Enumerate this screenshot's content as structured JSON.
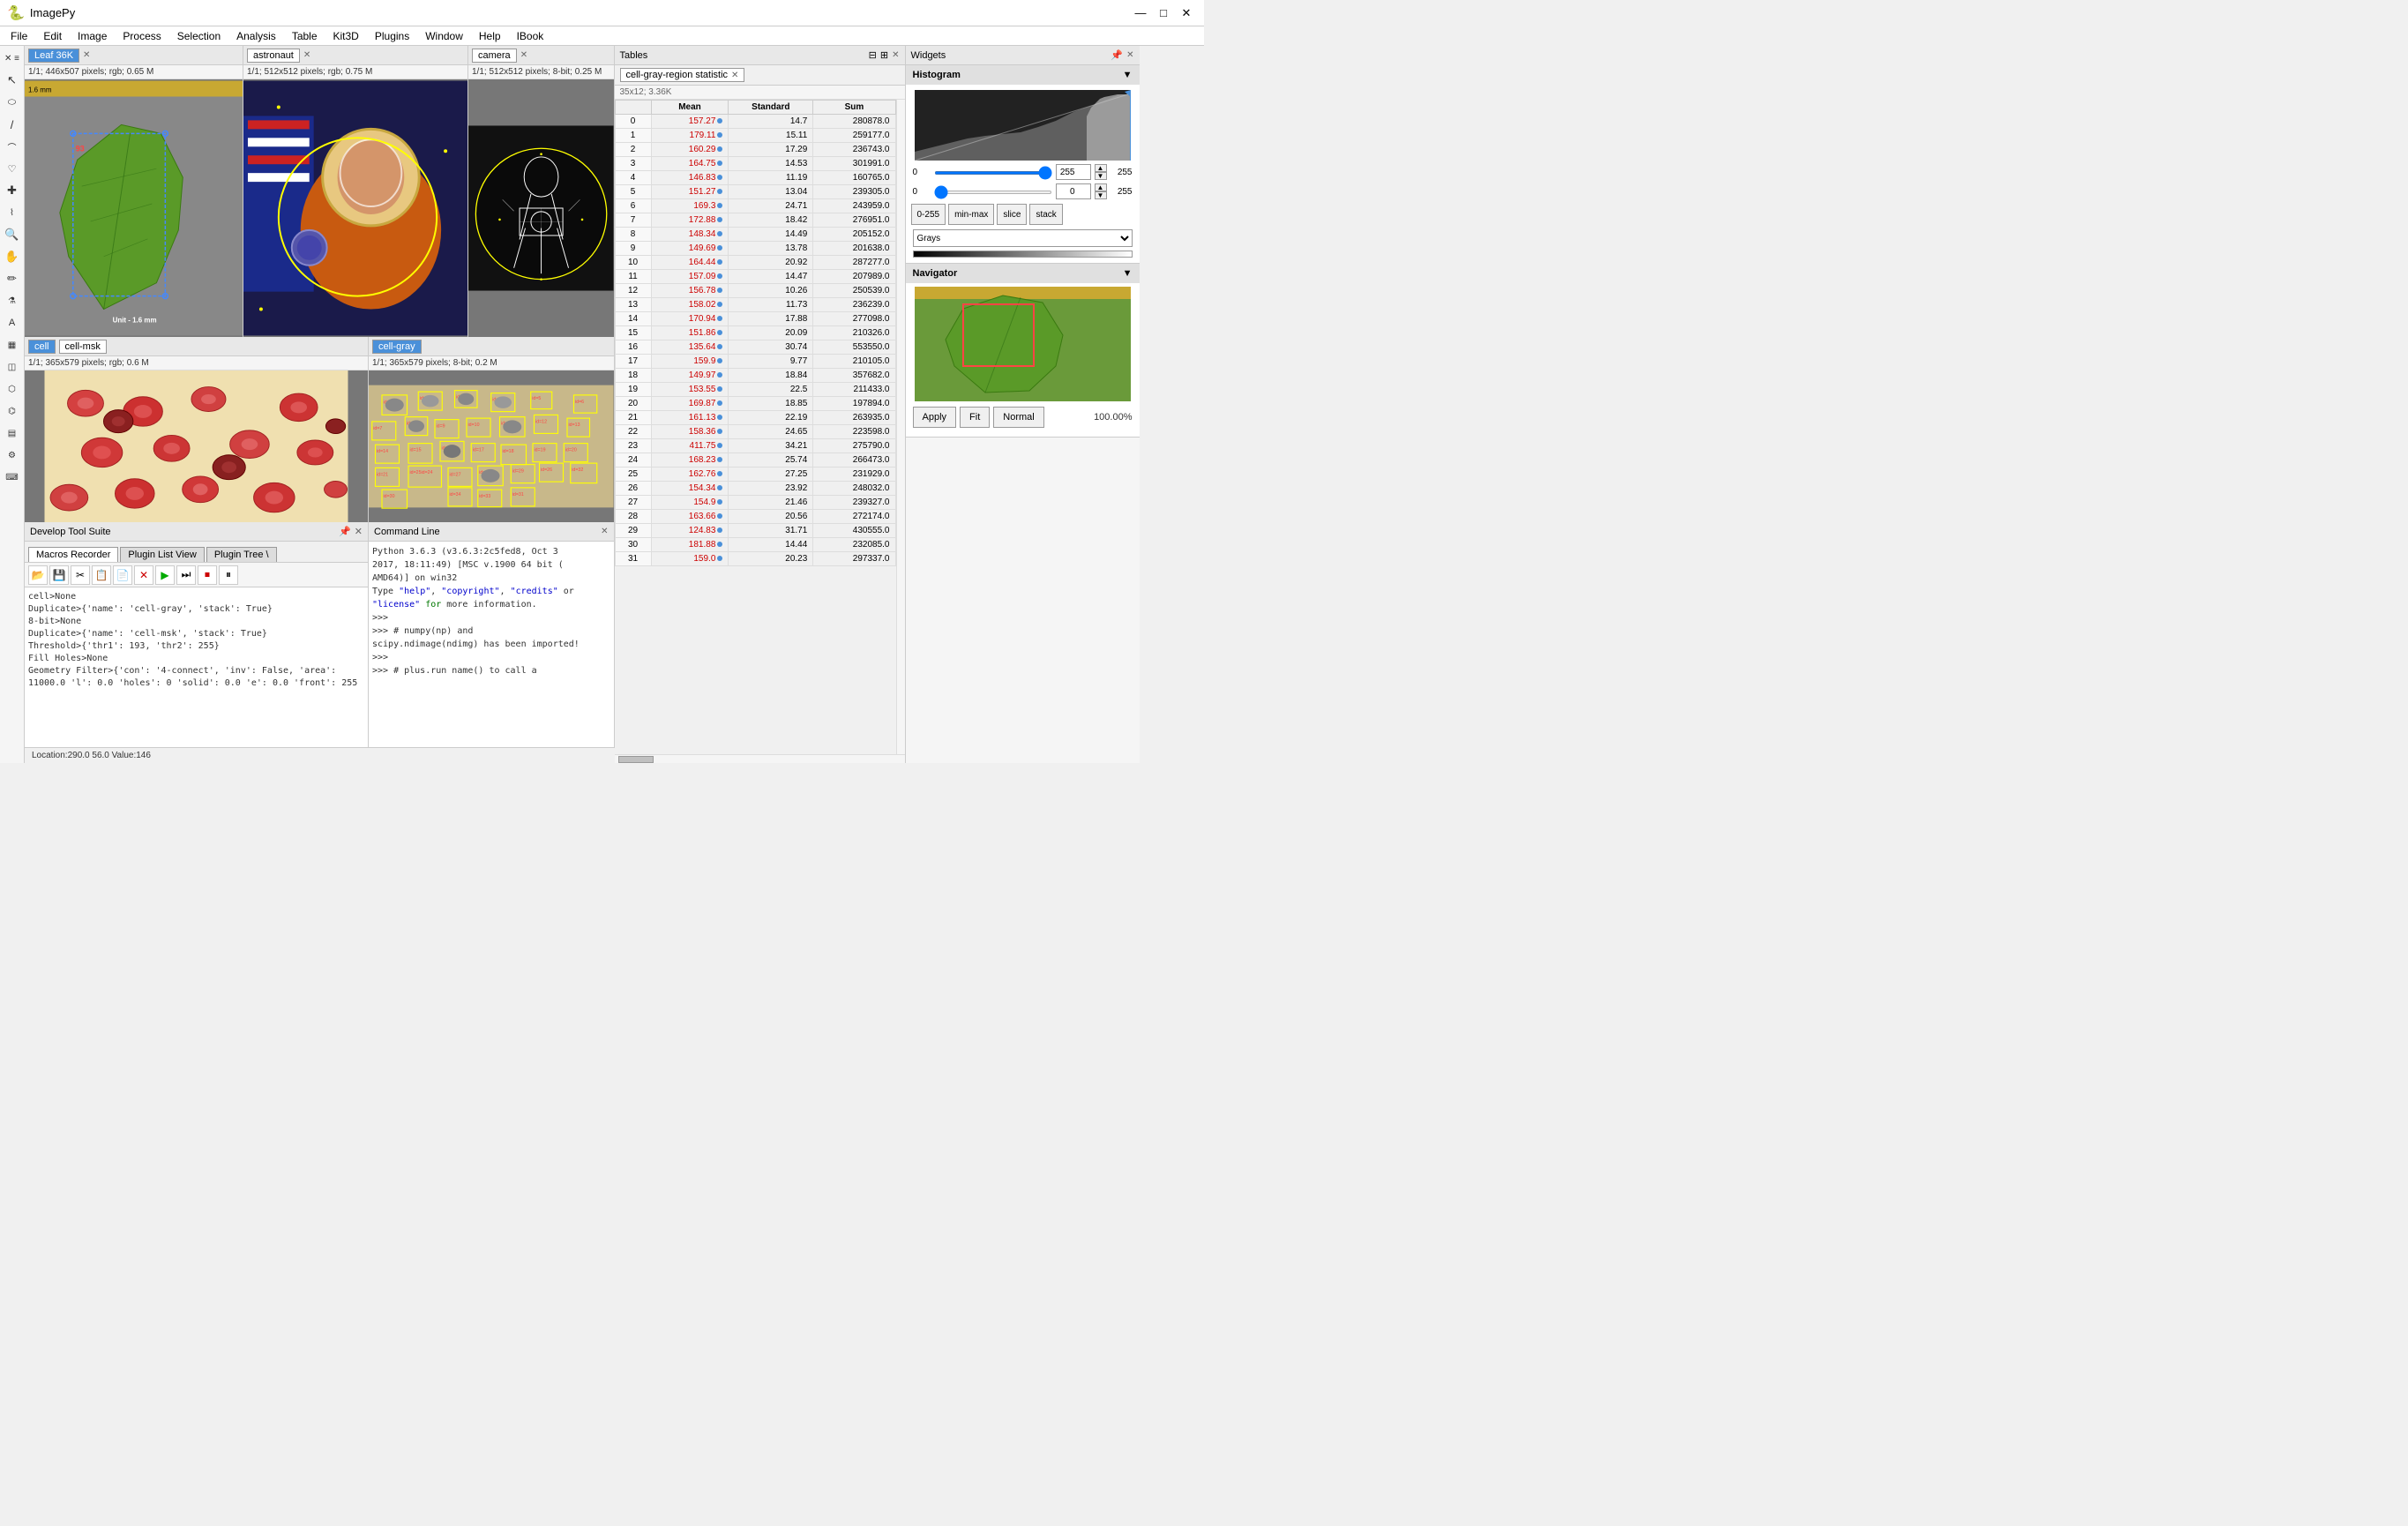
{
  "app": {
    "title": "ImagePy",
    "icon": "🐍"
  },
  "titlebar": {
    "title": "ImagePy",
    "minimize": "—",
    "maximize": "□",
    "close": "✕"
  },
  "menubar": {
    "items": [
      "File",
      "Edit",
      "Image",
      "Process",
      "Selection",
      "Analysis",
      "Table",
      "Kit3D",
      "Plugins",
      "Window",
      "Help",
      "IBook"
    ]
  },
  "tabs": {
    "leaf": "Leaf 36K",
    "astronaut": "astronaut",
    "camera": "camera",
    "cell": "cell",
    "cellmsk": "cell-msk",
    "cellgray": "cell-gray"
  },
  "image_info": {
    "leaf": "1/1;  446x507 pixels; rgb; 0.65 M",
    "astronaut": "1/1;  512x512 pixels; rgb; 0.75 M",
    "camera": "1/1;  512x512 pixels; 8-bit; 0.25 M",
    "cell": "1/1;  365x579 pixels; rgb; 0.6 M",
    "cellgray": "1/1;  365x579 pixels; 8-bit; 0.2 M"
  },
  "tables": {
    "header": "Tables",
    "tab_name": "cell-gray-region statistic",
    "info": "35x12; 3.36K",
    "columns": [
      "",
      "Mean",
      "Standard",
      "Sum"
    ],
    "rows": [
      {
        "idx": "0",
        "mean": "157.27",
        "std": "14.7",
        "sum": "280878.0"
      },
      {
        "idx": "1",
        "mean": "179.11",
        "std": "15.11",
        "sum": "259177.0"
      },
      {
        "idx": "2",
        "mean": "160.29",
        "std": "17.29",
        "sum": "236743.0"
      },
      {
        "idx": "3",
        "mean": "164.75",
        "std": "14.53",
        "sum": "301991.0"
      },
      {
        "idx": "4",
        "mean": "146.83",
        "std": "11.19",
        "sum": "160765.0"
      },
      {
        "idx": "5",
        "mean": "151.27",
        "std": "13.04",
        "sum": "239305.0"
      },
      {
        "idx": "6",
        "mean": "169.3",
        "std": "24.71",
        "sum": "243959.0"
      },
      {
        "idx": "7",
        "mean": "172.88",
        "std": "18.42",
        "sum": "276951.0"
      },
      {
        "idx": "8",
        "mean": "148.34",
        "std": "14.49",
        "sum": "205152.0"
      },
      {
        "idx": "9",
        "mean": "149.69",
        "std": "13.78",
        "sum": "201638.0"
      },
      {
        "idx": "10",
        "mean": "164.44",
        "std": "20.92",
        "sum": "287277.0"
      },
      {
        "idx": "11",
        "mean": "157.09",
        "std": "14.47",
        "sum": "207989.0"
      },
      {
        "idx": "12",
        "mean": "156.78",
        "std": "10.26",
        "sum": "250539.0"
      },
      {
        "idx": "13",
        "mean": "158.02",
        "std": "11.73",
        "sum": "236239.0"
      },
      {
        "idx": "14",
        "mean": "170.94",
        "std": "17.88",
        "sum": "277098.0"
      },
      {
        "idx": "15",
        "mean": "151.86",
        "std": "20.09",
        "sum": "210326.0"
      },
      {
        "idx": "16",
        "mean": "135.64",
        "std": "30.74",
        "sum": "553550.0"
      },
      {
        "idx": "17",
        "mean": "159.9",
        "std": "9.77",
        "sum": "210105.0"
      },
      {
        "idx": "18",
        "mean": "149.97",
        "std": "18.84",
        "sum": "357682.0"
      },
      {
        "idx": "19",
        "mean": "153.55",
        "std": "22.5",
        "sum": "211433.0"
      },
      {
        "idx": "20",
        "mean": "169.87",
        "std": "18.85",
        "sum": "197894.0"
      },
      {
        "idx": "21",
        "mean": "161.13",
        "std": "22.19",
        "sum": "263935.0"
      },
      {
        "idx": "22",
        "mean": "158.36",
        "std": "24.65",
        "sum": "223598.0"
      },
      {
        "idx": "23",
        "mean": "411.75",
        "std": "34.21",
        "sum": "275790.0"
      },
      {
        "idx": "24",
        "mean": "168.23",
        "std": "25.74",
        "sum": "266473.0"
      },
      {
        "idx": "25",
        "mean": "162.76",
        "std": "27.25",
        "sum": "231929.0"
      },
      {
        "idx": "26",
        "mean": "154.34",
        "std": "23.92",
        "sum": "248032.0"
      },
      {
        "idx": "27",
        "mean": "154.9",
        "std": "21.46",
        "sum": "239327.0"
      },
      {
        "idx": "28",
        "mean": "163.66",
        "std": "20.56",
        "sum": "272174.0"
      },
      {
        "idx": "29",
        "mean": "124.83",
        "std": "31.71",
        "sum": "430555.0"
      },
      {
        "idx": "30",
        "mean": "181.88",
        "std": "14.44",
        "sum": "232085.0"
      },
      {
        "idx": "31",
        "mean": "159.0",
        "std": "20.23",
        "sum": "297337.0"
      }
    ]
  },
  "widgets": {
    "header": "Widgets",
    "histogram_label": "Histogram",
    "navigator_label": "Navigator",
    "min_val": "0",
    "max_val": "255",
    "low_val": "0",
    "high_val": "255",
    "btn_0255": "0-255",
    "btn_minmax": "min-max",
    "btn_slice": "slice",
    "btn_stack": "stack",
    "colormap": "Grays",
    "btn_apply": "Apply",
    "btn_fit": "Fit",
    "btn_normal": "Normal",
    "zoom": "100.00%"
  },
  "develop_tool": {
    "header": "Develop Tool Suite",
    "tabs": [
      "Macros Recorder",
      "Plugin List View",
      "Plugin Tree \\"
    ],
    "content": [
      "cell>None",
      "Duplicate>{'name': 'cell-gray', 'stack': True}",
      "8-bit>None",
      "Duplicate>{'name': 'cell-msk', 'stack': True}",
      "Threshold>{'thr1': 193, 'thr2': 255}",
      "Fill Holes>None",
      "Geometry Filter>{'con': '4-connect', 'inv': False, 'area':",
      "11000.0, 'l': 0.0, 'holes': 0, 'solid': 0.0, 'e': 0.0, 'front': 255"
    ]
  },
  "command_line": {
    "header": "Command Line",
    "lines": [
      "Python 3.6.3 (v3.6.3:2c5fed8, Oct 3",
      "2017, 18:11:49) [MSC v.1900 64 bit (",
      "AMD64)] on win32",
      "Type \"help\", \"copyright\", \"credits\" or",
      "\"license\" for more information.",
      ">>> ",
      ">>> # numpy(np) and",
      "scipy.ndimage(ndimg) has been imported!",
      ">>> ",
      ">>> # plus.run name() to call a"
    ]
  },
  "statusbar": {
    "text": "Location:290.0  56.0  Value:146"
  },
  "unit_label": "Unit - 1.6 mm"
}
